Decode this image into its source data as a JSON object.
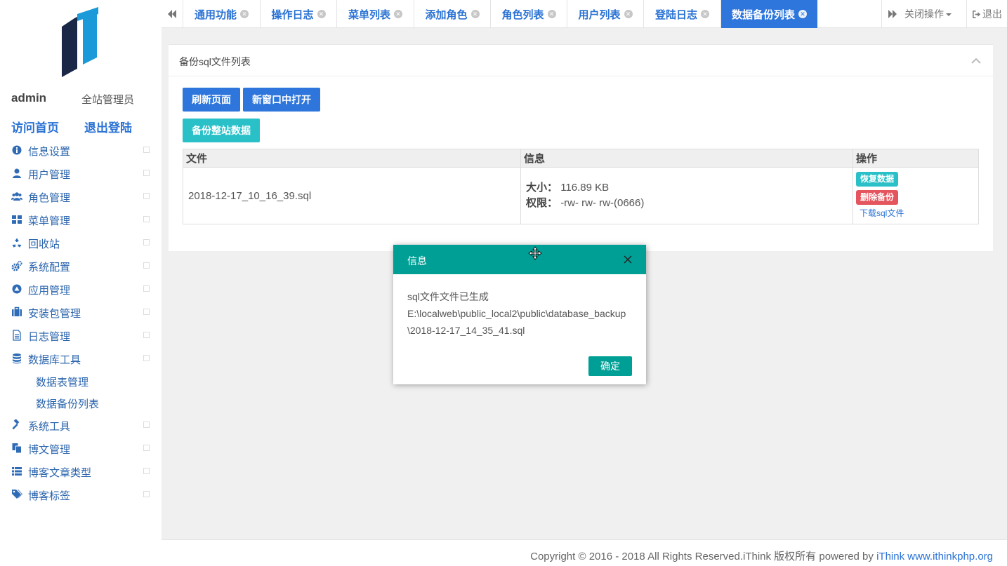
{
  "sidebar": {
    "logo_text": "IT",
    "user": {
      "name": "admin",
      "role": "全站管理员"
    },
    "links": {
      "home": "访问首页",
      "logout": "退出登陆"
    },
    "items": [
      {
        "label": "信息设置",
        "icon": "info-icon"
      },
      {
        "label": "用户管理",
        "icon": "user-icon"
      },
      {
        "label": "角色管理",
        "icon": "users-icon"
      },
      {
        "label": "菜单管理",
        "icon": "grid-icon"
      },
      {
        "label": "回收站",
        "icon": "recycle-icon"
      },
      {
        "label": "系统配置",
        "icon": "cogs-icon"
      },
      {
        "label": "应用管理",
        "icon": "app-icon"
      },
      {
        "label": "安装包管理",
        "icon": "briefcase-icon"
      },
      {
        "label": "日志管理",
        "icon": "file-icon"
      },
      {
        "label": "数据库工具",
        "icon": "database-icon"
      }
    ],
    "sub_items": [
      {
        "label": "数据表管理"
      },
      {
        "label": "数据备份列表"
      }
    ],
    "items_after": [
      {
        "label": "系统工具",
        "icon": "gavel-icon"
      },
      {
        "label": "博文管理",
        "icon": "copy-icon"
      },
      {
        "label": "博客文章类型",
        "icon": "list-icon"
      },
      {
        "label": "博客标签",
        "icon": "tags-icon"
      }
    ]
  },
  "tabs": [
    {
      "label": "通用功能",
      "active": false
    },
    {
      "label": "操作日志",
      "active": false
    },
    {
      "label": "菜单列表",
      "active": false
    },
    {
      "label": "添加角色",
      "active": false
    },
    {
      "label": "角色列表",
      "active": false
    },
    {
      "label": "用户列表",
      "active": false
    },
    {
      "label": "登陆日志",
      "active": false
    },
    {
      "label": "数据备份列表",
      "active": true
    }
  ],
  "topbar": {
    "close_ops": "关闭操作",
    "logout": "退出"
  },
  "panel": {
    "title": "备份sql文件列表",
    "buttons": {
      "refresh": "刷新页面",
      "new_window": "新窗口中打开",
      "backup": "备份整站数据"
    },
    "table": {
      "headers": [
        "文件",
        "信息",
        "操作"
      ],
      "rows": [
        {
          "file": "2018-12-17_10_16_39.sql",
          "size_label": "大小：",
          "size": "116.89 KB",
          "perm_label": "权限：",
          "perm": "-rw- rw- rw-(0666)",
          "ops": {
            "restore": "恢复数据",
            "delete": "删除备份",
            "download": "下载sql文件"
          }
        }
      ]
    }
  },
  "dialog": {
    "title": "信息",
    "lines": [
      "sql文件文件已生成",
      "E:\\localweb\\public_local2\\public\\database_backup",
      "\\2018-12-17_14_35_41.sql"
    ],
    "ok": "确定"
  },
  "footer": {
    "text": "Copyright © 2016 - 2018 All Rights Reserved.iThink 版权所有 powered by ",
    "brand": "iThink",
    "url": "www.ithinkphp.org"
  },
  "colors": {
    "primary": "#2e76dc",
    "teal": "#29c0c8",
    "danger": "#e4555e",
    "dialog": "#009f95",
    "logo_dark": "#1a2746",
    "logo_light": "#1a9ad8"
  }
}
